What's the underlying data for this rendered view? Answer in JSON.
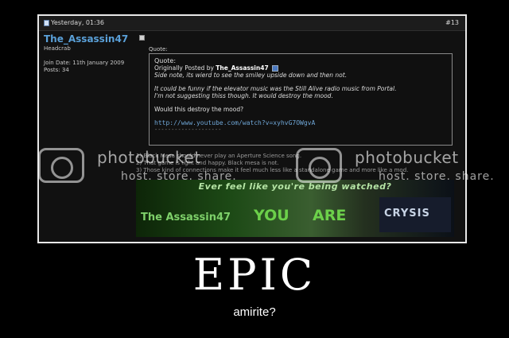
{
  "post": {
    "date": "Yesterday, 01:36",
    "number": "#13",
    "username": "The_Assassin47",
    "user_title": "Headcrab",
    "join_date": "Join Date: 11th January 2009",
    "posts": "Posts: 34"
  },
  "quote": {
    "label": "Quote:",
    "inner_label": "Quote:",
    "originally_posted_by": "Originally Posted by",
    "author": "The_Assassin47",
    "line1": "Side note, its wierd to see the smiley upside down and then not.",
    "line2": "It could be funny if the elevator music was the Still Alive radio music from Portal.",
    "line3": "I'm not suggesting thiss though. It would destroy the mood.",
    "question": "Would this destroy the mood?",
    "link": "http://www.youtube.com/watch?v=xyhvG7OWgvA",
    "separator": "--------------------"
  },
  "reply": {
    "line1": "1) Black Mesa should never play an Aperture Science song.",
    "line2": "2) That game is light and happy. Black mesa is not.",
    "line3": "3) Those kind of connections make it feel much less like a standalone game and more like a mod."
  },
  "banner": {
    "tagline": "Ever feel like you're being watched?",
    "name": "The Assassin47",
    "word1": "YOU",
    "word2": "ARE",
    "logo": "CRYSIS"
  },
  "watermark": {
    "line1": "photobucket",
    "line2": "host. store. share."
  },
  "caption": {
    "title": "EPIC",
    "subtitle": "amirite?"
  }
}
